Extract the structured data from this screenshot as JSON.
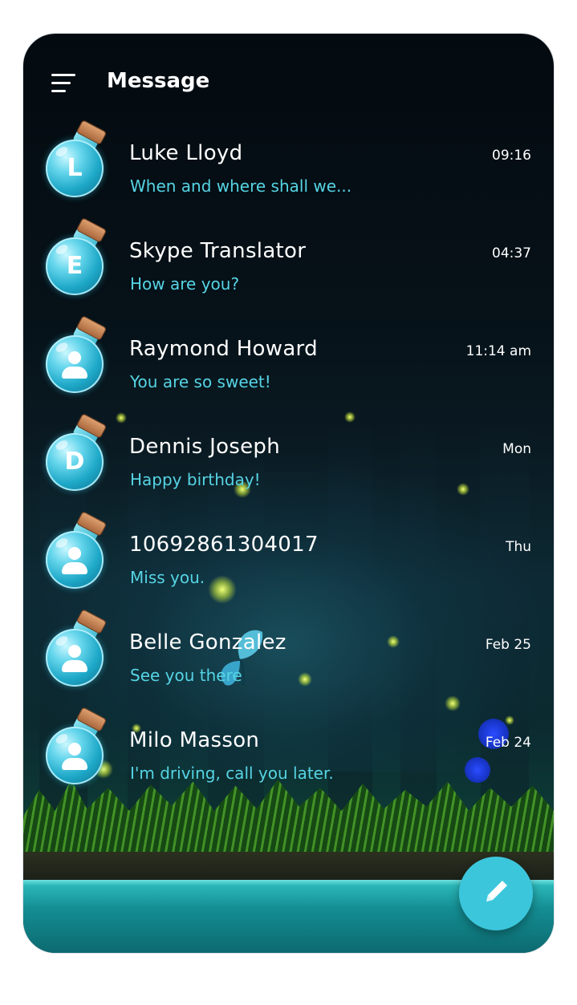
{
  "header": {
    "title": "Message",
    "menu_icon": "hamburger-menu-icon"
  },
  "conversations": [
    {
      "name": "Luke Lloyd",
      "preview": "When and where shall we...",
      "time": "09:16",
      "avatar": {
        "type": "letter",
        "letter": "L"
      }
    },
    {
      "name": "Skype Translator",
      "preview": "How are you?",
      "time": "04:37",
      "avatar": {
        "type": "letter",
        "letter": "E"
      }
    },
    {
      "name": "Raymond Howard",
      "preview": "You are so sweet!",
      "time": "11:14 am",
      "avatar": {
        "type": "person"
      }
    },
    {
      "name": "Dennis Joseph",
      "preview": "Happy birthday!",
      "time": "Mon",
      "avatar": {
        "type": "letter",
        "letter": "D"
      }
    },
    {
      "name": "10692861304017",
      "preview": "Miss you.",
      "time": "Thu",
      "avatar": {
        "type": "person"
      }
    },
    {
      "name": "Belle Gonzalez",
      "preview": "See you there",
      "time": "Feb 25",
      "avatar": {
        "type": "person"
      }
    },
    {
      "name": "Milo Masson",
      "preview": "I'm driving, call you later.",
      "time": "Feb 24",
      "avatar": {
        "type": "person"
      }
    }
  ],
  "fab": {
    "icon": "pencil-icon",
    "color": "#3cc6dc"
  },
  "colors": {
    "preview_text": "#56d4e4",
    "name_text": "#ffffff",
    "background": "#040b10"
  }
}
